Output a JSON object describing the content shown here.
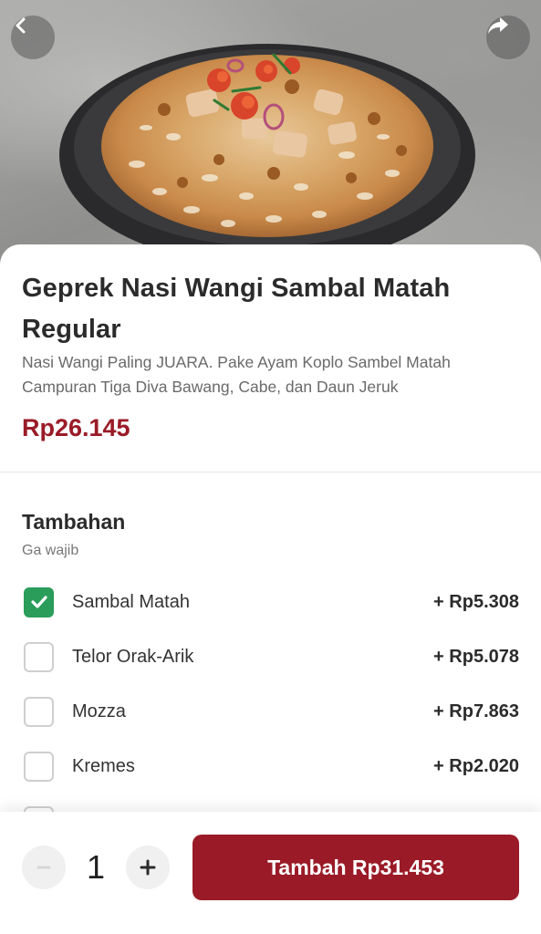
{
  "colors": {
    "brand": "#9a1b27",
    "checked": "#2a9d5a",
    "text_primary": "#2b2b2b",
    "text_secondary": "#6a6a6a"
  },
  "header": {
    "back_icon": "chevron-left-icon",
    "share_icon": "share-arrow-icon"
  },
  "product": {
    "name": "Geprek Nasi Wangi Sambal Matah Regular",
    "description": "Nasi Wangi Paling JUARA. Pake Ayam Koplo Sambel Matah Campuran Tiga Diva Bawang, Cabe, dan Daun Jeruk",
    "price": "Rp26.145"
  },
  "addons": {
    "heading": "Tambahan",
    "subheading": "Ga wajib",
    "items": [
      {
        "name": "Sambal Matah",
        "price": "+ Rp5.308",
        "checked": true
      },
      {
        "name": "Telor Orak-Arik",
        "price": "+ Rp5.078",
        "checked": false
      },
      {
        "name": "Mozza",
        "price": "+ Rp7.863",
        "checked": false
      },
      {
        "name": "Kremes",
        "price": "+ Rp2.020",
        "checked": false
      }
    ]
  },
  "cart": {
    "quantity": "1",
    "minus_icon": "minus-icon",
    "plus_icon": "plus-icon",
    "add_label": "Tambah Rp31.453"
  }
}
